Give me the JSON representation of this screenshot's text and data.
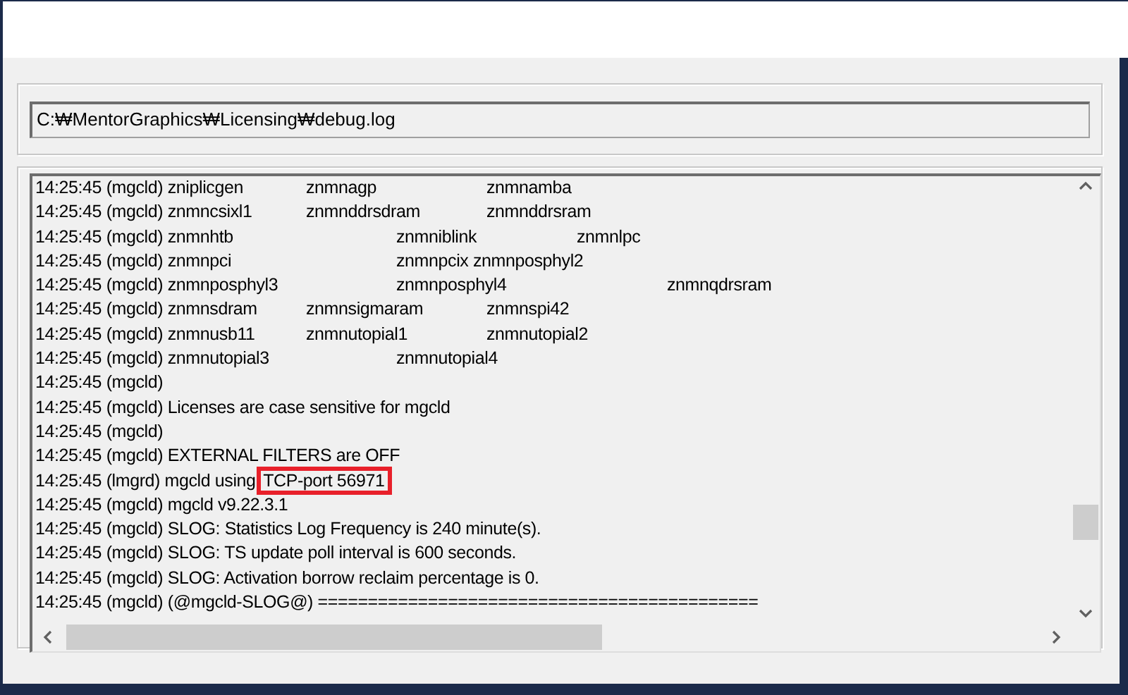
{
  "path_field": {
    "value": "C:₩MentorGraphics₩Licensing₩debug.log"
  },
  "log_lines": [
    {
      "text": "14:25:45 (mgcld) zniplicgen\tznmnagp\t\tznmnamba"
    },
    {
      "text": "14:25:45 (mgcld) znmncsixl1\tznmnddrsdram\tznmnddrsram"
    },
    {
      "text": "14:25:45 (mgcld) znmnhtb\t\tznmniblink\t\tznmnlpc"
    },
    {
      "text": "14:25:45 (mgcld) znmnpci\t\tznmnpcix znmnposphyl2"
    },
    {
      "text": "14:25:45 (mgcld) znmnposphyl3\t\tznmnposphyl4\t\tznmnqdrsram"
    },
    {
      "text": "14:25:45 (mgcld) znmnsdram\tznmnsigmaram\tznmnspi42"
    },
    {
      "text": "14:25:45 (mgcld) znmnusb11\tznmnutopial1\tznmnutopial2"
    },
    {
      "text": "14:25:45 (mgcld) znmnutopial3\t\tznmnutopial4"
    },
    {
      "text": "14:25:45 (mgcld)"
    },
    {
      "text": "14:25:45 (mgcld) Licenses are case sensitive for mgcld"
    },
    {
      "text": "14:25:45 (mgcld)"
    },
    {
      "text": "14:25:45 (mgcld) EXTERNAL FILTERS are OFF"
    },
    {
      "text": "14:25:45 (lmgrd) mgcld using ",
      "highlight": "TCP-port 56971"
    },
    {
      "text": "14:25:45 (mgcld) mgcld v9.22.3.1"
    },
    {
      "text": "14:25:45 (mgcld) SLOG: Statistics Log Frequency is 240 minute(s)."
    },
    {
      "text": "14:25:45 (mgcld) SLOG: TS update poll interval is 600 seconds."
    },
    {
      "text": "14:25:45 (mgcld) SLOG: Activation borrow reclaim percentage is 0."
    },
    {
      "text": "14:25:45 (mgcld) (@mgcld-SLOG@) ============================================"
    }
  ]
}
